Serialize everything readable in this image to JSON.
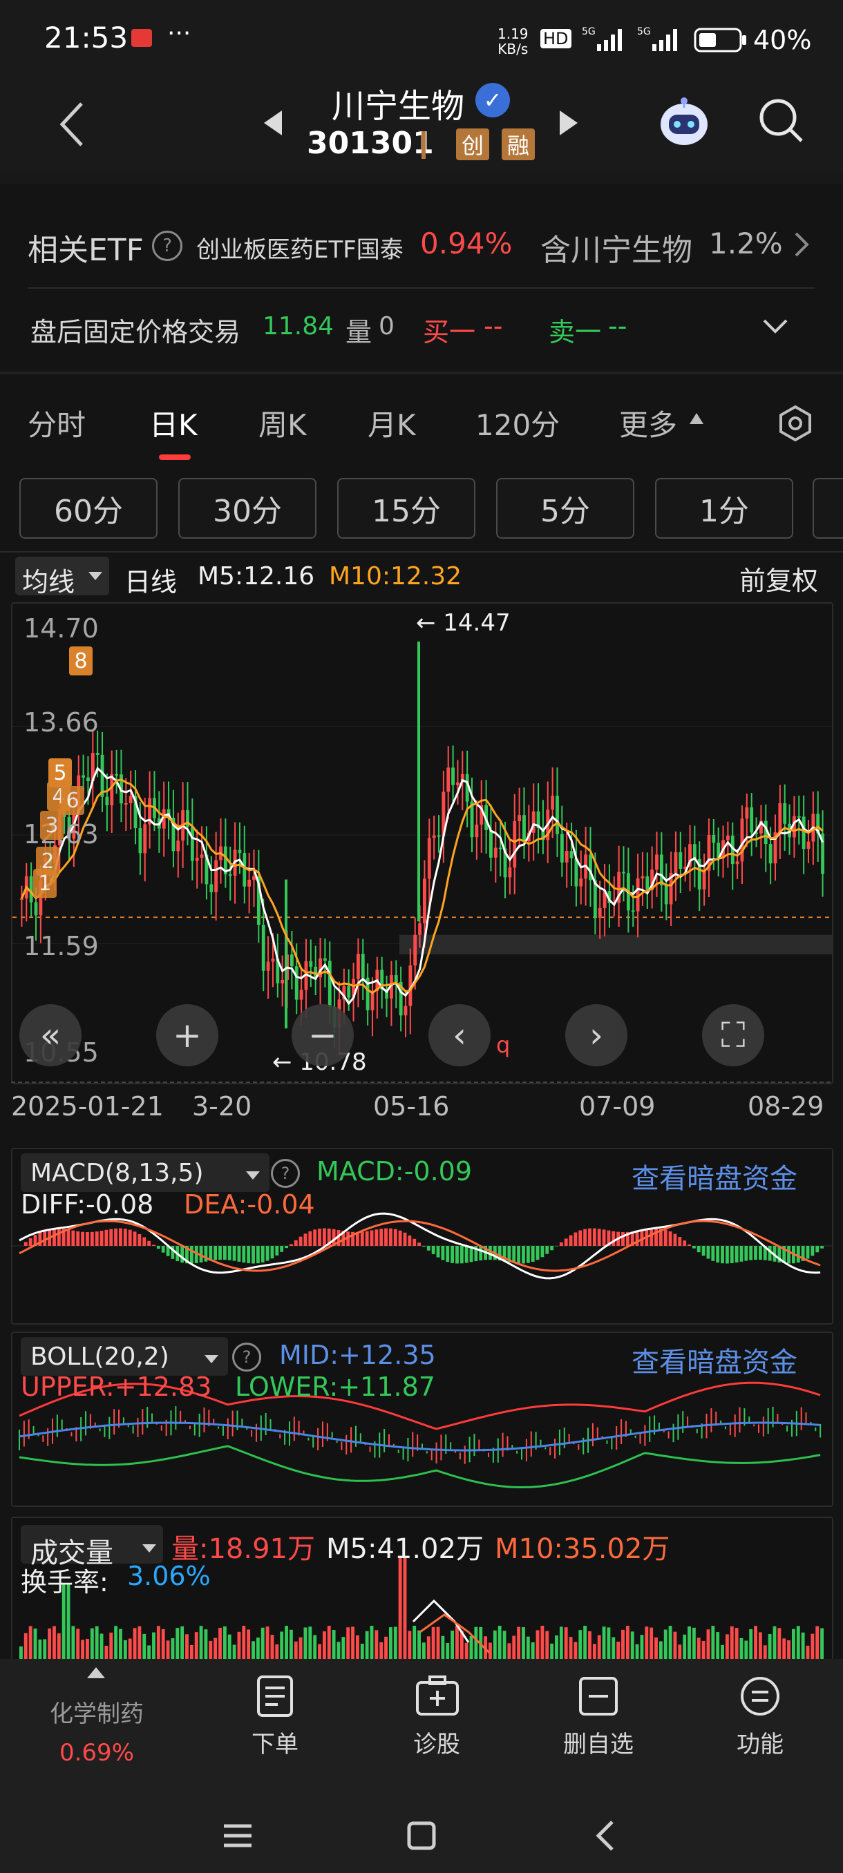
{
  "status": {
    "time": "21:53",
    "net_speed_top": "1.19",
    "net_speed_bottom": "KB/s",
    "hd": "HD",
    "net1": "5G",
    "net2": "5G",
    "battery": "40%"
  },
  "header": {
    "stock_name": "川宁生物",
    "stock_code": "301301",
    "badge1": "创",
    "badge2": "融"
  },
  "etf": {
    "label": "相关ETF",
    "name": "创业板医药ETF国泰",
    "change": "0.94%",
    "contains": "含川宁生物",
    "weight": "1.2%"
  },
  "after_hours": {
    "label": "盘后固定价格交易",
    "price": "11.84",
    "vol_label": "量",
    "vol": "0",
    "buy_label": "买一",
    "buy_val": "--",
    "sell_label": "卖一",
    "sell_val": "--"
  },
  "tabs": [
    "分时",
    "日K",
    "周K",
    "月K",
    "120分",
    "更多"
  ],
  "subtabs": [
    "60分",
    "30分",
    "15分",
    "5分",
    "1分"
  ],
  "ma_bar": {
    "selector": "均线",
    "period": "日线",
    "m5": "M5:12.16",
    "m10": "M10:12.32",
    "adjust": "前复权"
  },
  "price_chart": {
    "y_labels": [
      "14.70",
      "13.66",
      "12.63",
      "11.59",
      "10.55"
    ],
    "high_label": "14.47",
    "low_label": "10.78",
    "dates": [
      "2025-01-21",
      "3-20",
      "05-16",
      "07-09",
      "08-29"
    ],
    "markers": [
      "8",
      "5",
      "4",
      "6",
      "3",
      "2",
      "1"
    ],
    "q_label": "q"
  },
  "macd": {
    "selector": "MACD(8,13,5)",
    "macd": "MACD:-0.09",
    "diff": "DIFF:-0.08",
    "dea": "DEA:-0.04",
    "link": "查看暗盘资金"
  },
  "boll": {
    "selector": "BOLL(20,2)",
    "mid": "MID:+12.35",
    "upper": "UPPER:+12.83",
    "lower": "LOWER:+11.87",
    "link": "查看暗盘资金"
  },
  "volume": {
    "selector": "成交量",
    "vol": "量:18.91万",
    "m5": "M5:41.02万",
    "m10": "M10:35.02万",
    "turnover_label": "换手率:",
    "turnover": "3.06%"
  },
  "bottom_nav": {
    "sector": "化学制药",
    "sector_change": "0.69%",
    "order": "下单",
    "diagnose": "诊股",
    "remove": "删自选",
    "function": "功能"
  },
  "colors": {
    "up": "#ff4a4a",
    "down": "#34c759",
    "ma5": "#ffffff",
    "ma10": "#ffa520",
    "link": "#5c8fe6"
  },
  "chart_data": {
    "type": "candlestick",
    "title": "",
    "x_range": [
      "2025-01-21",
      "08-29"
    ],
    "y_range": [
      10.55,
      14.7
    ],
    "close_approx": [
      11.9,
      12.3,
      12.9,
      13.3,
      13.0,
      12.7,
      12.8,
      12.5,
      12.2,
      12.5,
      11.5,
      11.2,
      11.4,
      11.0,
      11.3,
      11.1,
      11.2,
      12.8,
      13.2,
      12.6,
      12.4,
      12.8,
      12.7,
      12.2,
      12.0,
      12.1,
      12.2,
      12.3,
      12.4,
      12.5,
      12.7,
      12.6,
      12.8,
      12.4
    ]
  }
}
